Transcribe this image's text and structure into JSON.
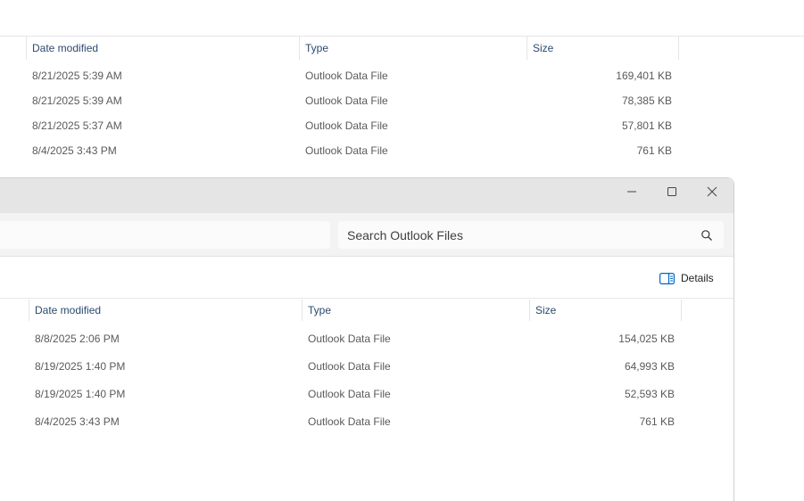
{
  "background_window": {
    "columns": {
      "date": "Date modified",
      "type": "Type",
      "size": "Size"
    },
    "rows": [
      {
        "date": "8/21/2025 5:39 AM",
        "type": "Outlook Data File",
        "size": "169,401 KB"
      },
      {
        "date": "8/21/2025 5:39 AM",
        "type": "Outlook Data File",
        "size": "78,385 KB"
      },
      {
        "date": "8/21/2025 5:37 AM",
        "type": "Outlook Data File",
        "size": "57,801 KB"
      },
      {
        "date": "8/4/2025 3:43 PM",
        "type": "Outlook Data File",
        "size": "761 KB"
      }
    ]
  },
  "foreground_window": {
    "titlebar": {
      "minimize_icon": "minimize-icon",
      "maximize_icon": "maximize-icon",
      "close_icon": "close-icon"
    },
    "search": {
      "placeholder": "Search Outlook Files",
      "icon": "search-icon"
    },
    "toolbar": {
      "details_label": "Details",
      "details_icon": "details-pane-icon"
    },
    "columns": {
      "date": "Date modified",
      "type": "Type",
      "size": "Size"
    },
    "rows": [
      {
        "date": "8/8/2025 2:06 PM",
        "type": "Outlook Data File",
        "size": "154,025 KB"
      },
      {
        "date": "8/19/2025 1:40 PM",
        "type": "Outlook Data File",
        "size": "64,993 KB"
      },
      {
        "date": "8/19/2025 1:40 PM",
        "type": "Outlook Data File",
        "size": "52,593 KB"
      },
      {
        "date": "8/4/2025 3:43 PM",
        "type": "Outlook Data File",
        "size": "761 KB"
      }
    ]
  },
  "colors": {
    "accent_icon": "#0067c0",
    "header_text": "#2b4a6f",
    "cell_text": "#5a5a5a",
    "titlebar_bg": "#e5e5e5"
  }
}
